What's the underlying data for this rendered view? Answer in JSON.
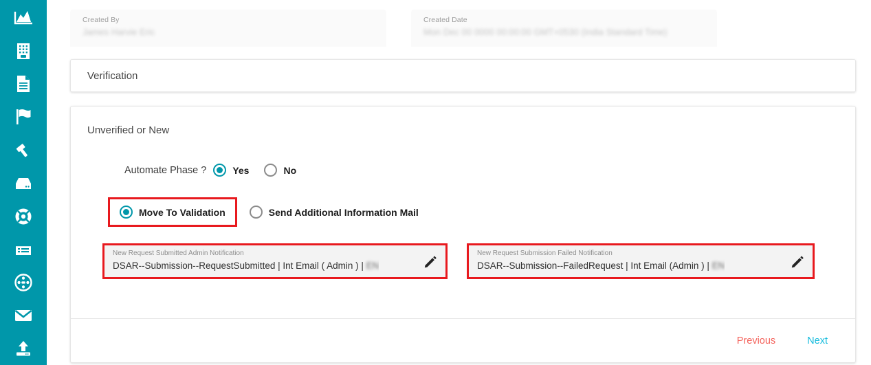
{
  "sidebar": {
    "items": [
      {
        "icon": "area-chart-icon",
        "name": "sidebar-item-dashboard"
      },
      {
        "icon": "building-icon",
        "name": "sidebar-item-organization"
      },
      {
        "icon": "document-icon",
        "name": "sidebar-item-documents"
      },
      {
        "icon": "flag-icon",
        "name": "sidebar-item-incidents"
      },
      {
        "icon": "gavel-icon",
        "name": "sidebar-item-legal"
      },
      {
        "icon": "inbox-icon",
        "name": "sidebar-item-inbox"
      },
      {
        "icon": "lifebuoy-icon",
        "name": "sidebar-item-support"
      },
      {
        "icon": "list-icon",
        "name": "sidebar-item-records"
      },
      {
        "icon": "network-icon",
        "name": "sidebar-item-network"
      },
      {
        "icon": "envelope-icon",
        "name": "sidebar-item-mail"
      },
      {
        "icon": "upload-icon",
        "name": "sidebar-item-upload"
      }
    ]
  },
  "meta": {
    "created_by": {
      "label": "Created By",
      "value": "James Harvie Eric"
    },
    "created_date": {
      "label": "Created Date",
      "value": "Mon Dec 00 0000 00:00:00 GMT+0530 (India Standard Time)"
    }
  },
  "verification": {
    "title": "Verification"
  },
  "phase": {
    "heading": "Unverified or New",
    "automate": {
      "label": "Automate Phase ?",
      "options": [
        {
          "label": "Yes",
          "selected": true
        },
        {
          "label": "No",
          "selected": false
        }
      ]
    },
    "action": {
      "options": [
        {
          "label": "Move To Validation",
          "selected": true,
          "highlighted": true
        },
        {
          "label": "Send Additional Information Mail",
          "selected": false,
          "highlighted": false
        }
      ]
    },
    "notifications": [
      {
        "label": "New Request Submitted Admin Notification",
        "value": "DSAR--Submission--RequestSubmitted | Int Email ( Admin ) | ",
        "value_tail": "EN",
        "edit_icon": "pencil-icon",
        "highlighted": true
      },
      {
        "label": "New Request Submission Failed Notification",
        "value": "DSAR--Submission--FailedRequest | Int Email (Admin ) | ",
        "value_tail": "EN",
        "edit_icon": "pencil-icon",
        "highlighted": true
      }
    ]
  },
  "footer": {
    "previous_label": "Previous",
    "next_label": "Next"
  },
  "colors": {
    "sidebar": "#0097aa",
    "accent_teal": "#0097aa",
    "highlight_red": "#e8191e",
    "previous": "#f4635c",
    "next": "#15bcdd"
  }
}
